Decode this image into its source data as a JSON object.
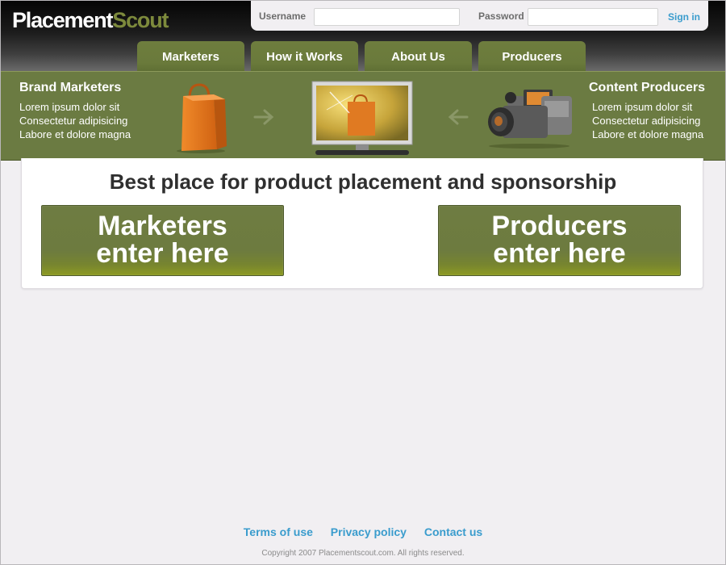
{
  "brand": {
    "part1": "Placement",
    "part2": "Scout"
  },
  "login": {
    "username_label": "Username",
    "username_value": "",
    "password_label": "Password",
    "password_value": "",
    "signin_label": "Sign in"
  },
  "nav": {
    "tabs": [
      {
        "label": "Marketers"
      },
      {
        "label": "How it Works"
      },
      {
        "label": "About Us"
      },
      {
        "label": "Producers"
      }
    ]
  },
  "hero": {
    "left": {
      "title": "Brand Marketers",
      "lines": [
        "Lorem ipsum dolor sit",
        "Consectetur adipisicing",
        "Labore et dolore magna"
      ]
    },
    "right": {
      "title": "Content Producers",
      "lines": [
        "Lorem ipsum dolor sit",
        "Consectetur adipisicing",
        "Labore et dolore magna"
      ]
    },
    "icons": [
      "shopping-bag-icon",
      "arrow-right-icon",
      "tv-monitor-icon",
      "arrow-left-icon",
      "video-camera-icon"
    ]
  },
  "main": {
    "headline": "Best place for product placement and sponsorship",
    "cta_marketers": {
      "line1": "Marketers",
      "line2": "enter here"
    },
    "cta_producers": {
      "line1": "Producers",
      "line2": "enter here"
    }
  },
  "footer": {
    "links": [
      "Terms of use",
      "Privacy policy",
      "Contact us"
    ],
    "copyright": "Copyright 2007 Placementscout.com. All rights reserved."
  },
  "colors": {
    "accent_green": "#6b7b42",
    "brand_green": "#7d8a3c",
    "link_blue": "#3a9ccd",
    "page_bg": "#f1eff2"
  }
}
